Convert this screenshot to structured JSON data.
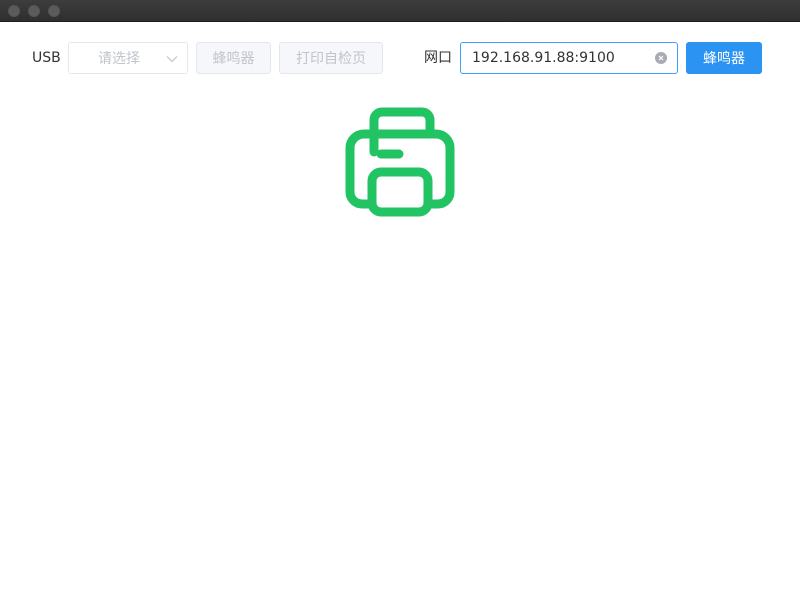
{
  "usb": {
    "label": "USB",
    "select_placeholder": "请选择",
    "buzzer_label": "蜂鸣器",
    "selftest_label": "打印自检页"
  },
  "network": {
    "label": "网口",
    "address_value": "192.168.91.88:9100",
    "buzzer_label": "蜂鸣器"
  },
  "icons": {
    "printer": "printer-icon",
    "chevron": "chevron-down-icon",
    "clear": "clear-icon"
  },
  "colors": {
    "printer_icon": "#22c363",
    "primary_button": "#2b93f2",
    "input_focus_border": "#409eff"
  }
}
